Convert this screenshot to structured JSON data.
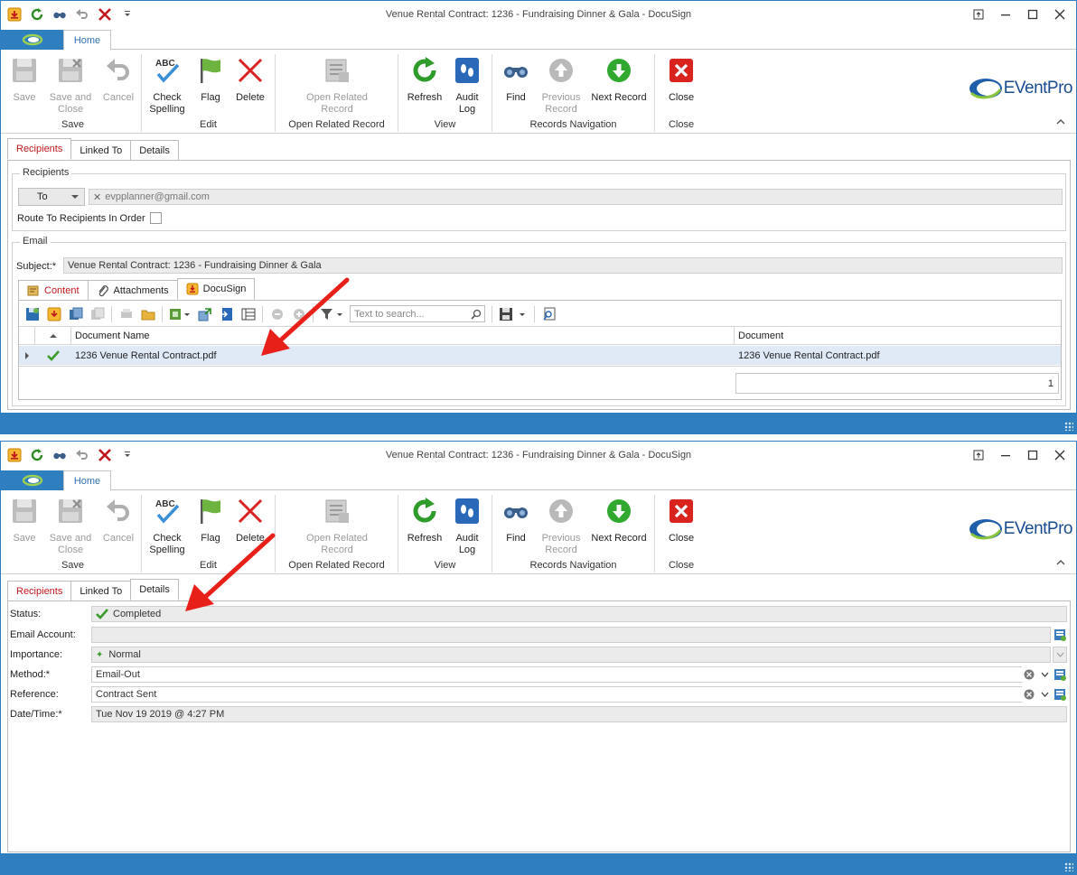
{
  "window_title": "Venue Rental Contract: 1236 - Fundraising Dinner & Gala - DocuSign",
  "ribbon": {
    "home_tab": "Home",
    "groups": {
      "save": "Save",
      "edit": "Edit",
      "open_related": "Open Related Record",
      "view": "View",
      "records_nav": "Records Navigation",
      "close": "Close"
    },
    "buttons": {
      "save": "Save",
      "save_close_1": "Save and",
      "save_close_2": "Close",
      "cancel": "Cancel",
      "check_1": "Check",
      "check_2": "Spelling",
      "flag": "Flag",
      "delete": "Delete",
      "open_rel_1": "Open Related",
      "open_rel_2": "Record",
      "refresh": "Refresh",
      "audit_1": "Audit",
      "audit_2": "Log",
      "find": "Find",
      "prev_1": "Previous",
      "prev_2": "Record",
      "next": "Next Record",
      "close": "Close"
    },
    "abc_text": "ABC"
  },
  "brand": {
    "logo_text": "EVentPro"
  },
  "tabs": {
    "recipients": "Recipients",
    "linked_to": "Linked To",
    "details": "Details"
  },
  "recipients": {
    "group_title": "Recipients",
    "to_value": "To",
    "email_chip": "evpplanner@gmail.com",
    "route_label": "Route To Recipients In Order"
  },
  "email": {
    "group_title": "Email",
    "subject_label": "Subject:*",
    "subject_value": "Venue Rental Contract: 1236 - Fundraising Dinner & Gala",
    "subtabs": {
      "content": "Content",
      "attachments": "Attachments",
      "docusign": "DocuSign"
    },
    "search_placeholder": "Text to search...",
    "grid": {
      "col_document_name": "Document Name",
      "col_document": "Document",
      "rows": [
        {
          "document_name": "1236 Venue Rental Contract.pdf",
          "document": "1236 Venue Rental Contract.pdf"
        }
      ],
      "count": "1"
    }
  },
  "details": {
    "status_label": "Status:",
    "status_value": "Completed",
    "email_account_label": "Email Account:",
    "email_account_value": "",
    "importance_label": "Importance:",
    "importance_value": "Normal",
    "method_label": "Method:*",
    "method_value": "Email-Out",
    "reference_label": "Reference:",
    "reference_value": "Contract Sent",
    "datetime_label": "Date/Time:*",
    "datetime_value": "Tue Nov 19 2019 @ 4:27 PM"
  },
  "colors": {
    "accent": "#2f7ec0",
    "arrow": "#e8201a",
    "tab_red": "#c0171c",
    "row_selected": "#dfeaf6"
  }
}
